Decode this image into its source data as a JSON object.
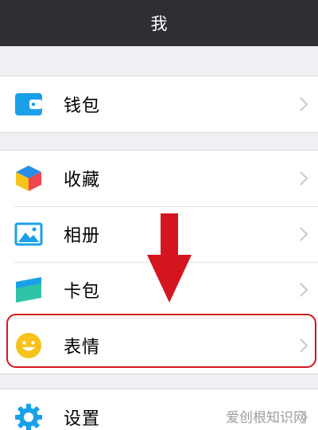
{
  "header": {
    "title": "我"
  },
  "groups": {
    "wallet": {
      "items": [
        {
          "label": "钱包",
          "icon": "wallet-icon"
        }
      ]
    },
    "main": {
      "items": [
        {
          "label": "收藏",
          "icon": "cube-icon"
        },
        {
          "label": "相册",
          "icon": "photo-icon"
        },
        {
          "label": "卡包",
          "icon": "card-icon"
        },
        {
          "label": "表情",
          "icon": "smiley-icon"
        }
      ]
    },
    "settings": {
      "items": [
        {
          "label": "设置",
          "icon": "gear-icon"
        }
      ]
    }
  },
  "annotation": {
    "arrow_color": "#d4151f",
    "highlight_color": "#d4151f",
    "highlighted_item": "表情"
  },
  "watermark": {
    "text": "爱创根知识网"
  },
  "colors": {
    "nav_bg": "#2e2f33",
    "page_bg": "#efeff4",
    "chevron": "#c7c7cc"
  }
}
